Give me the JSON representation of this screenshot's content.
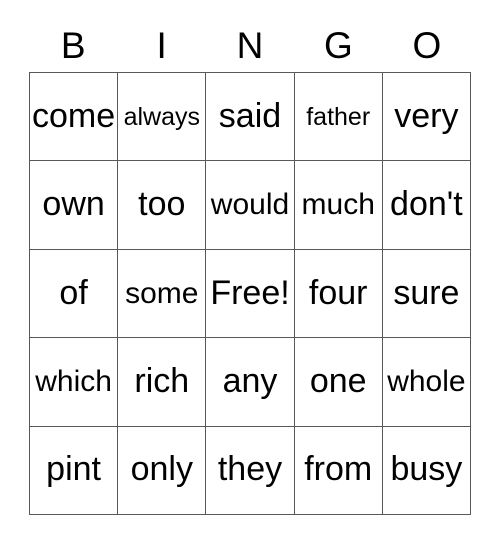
{
  "card": {
    "title": "BINGO",
    "header_letters": [
      "B",
      "I",
      "N",
      "G",
      "O"
    ],
    "grid_size": "5x5",
    "free_space": "Free!",
    "colors": {
      "background": "#ffffff",
      "text": "#000000",
      "grid_line": "#595959"
    },
    "rows": [
      {
        "cells": [
          {
            "text": "come",
            "size": "lg",
            "free": false
          },
          {
            "text": "always",
            "size": "sm",
            "free": false
          },
          {
            "text": "said",
            "size": "lg",
            "free": false
          },
          {
            "text": "father",
            "size": "sm",
            "free": false
          },
          {
            "text": "very",
            "size": "lg",
            "free": false
          }
        ]
      },
      {
        "cells": [
          {
            "text": "own",
            "size": "lg",
            "free": false
          },
          {
            "text": "too",
            "size": "lg",
            "free": false
          },
          {
            "text": "would",
            "size": "md",
            "free": false
          },
          {
            "text": "much",
            "size": "md",
            "free": false
          },
          {
            "text": "don't",
            "size": "lg",
            "free": false
          }
        ]
      },
      {
        "cells": [
          {
            "text": "of",
            "size": "lg",
            "free": false
          },
          {
            "text": "some",
            "size": "md",
            "free": false
          },
          {
            "text": "Free!",
            "size": "lg",
            "free": true
          },
          {
            "text": "four",
            "size": "lg",
            "free": false
          },
          {
            "text": "sure",
            "size": "lg",
            "free": false
          }
        ]
      },
      {
        "cells": [
          {
            "text": "which",
            "size": "md",
            "free": false
          },
          {
            "text": "rich",
            "size": "lg",
            "free": false
          },
          {
            "text": "any",
            "size": "lg",
            "free": false
          },
          {
            "text": "one",
            "size": "lg",
            "free": false
          },
          {
            "text": "whole",
            "size": "md",
            "free": false
          }
        ]
      },
      {
        "cells": [
          {
            "text": "pint",
            "size": "lg",
            "free": false
          },
          {
            "text": "only",
            "size": "lg",
            "free": false
          },
          {
            "text": "they",
            "size": "lg",
            "free": false
          },
          {
            "text": "from",
            "size": "lg",
            "free": false
          },
          {
            "text": "busy",
            "size": "lg",
            "free": false
          }
        ]
      }
    ]
  }
}
